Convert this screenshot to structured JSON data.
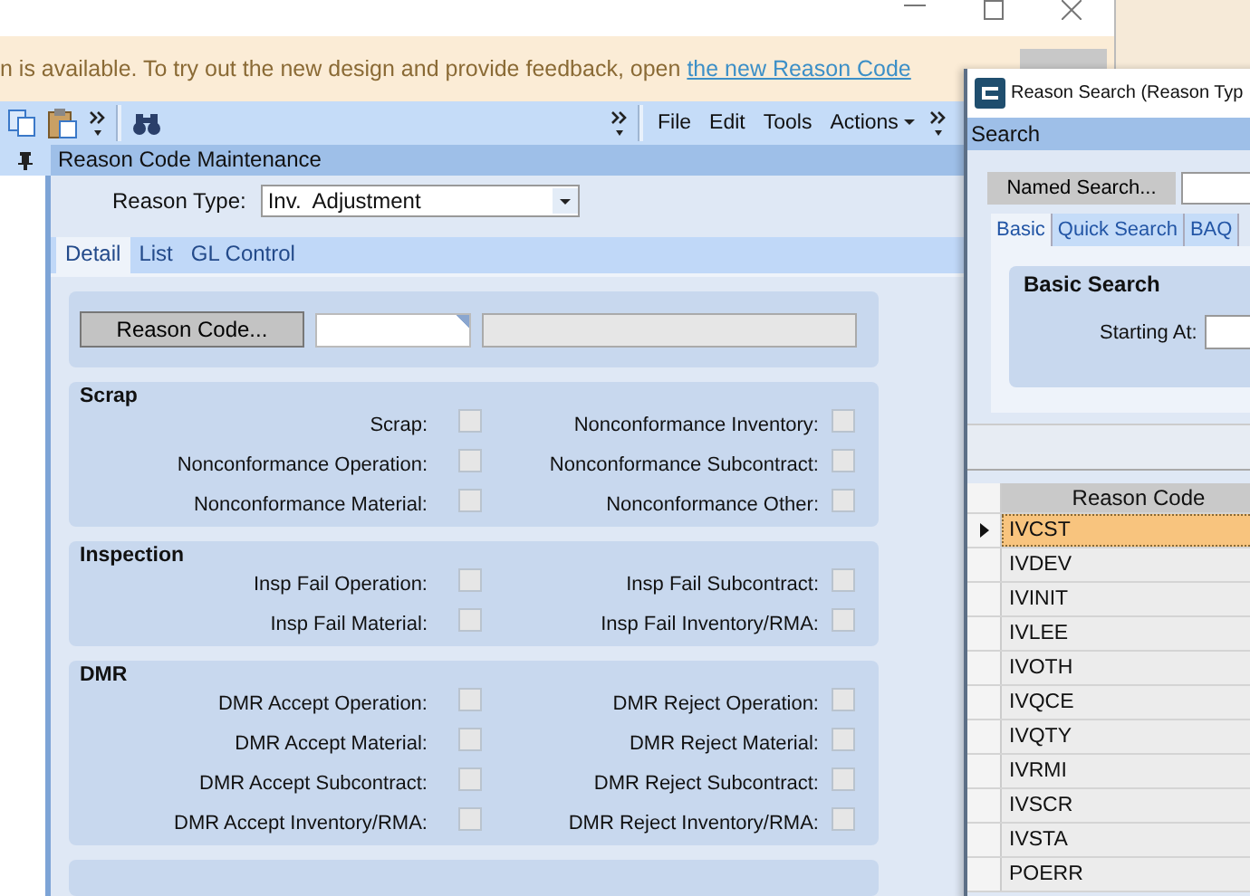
{
  "banner": {
    "text": "n is available. To try out the new design and provide feedback, open ",
    "link": "the new Reason Code"
  },
  "toolbar": {
    "menus": [
      {
        "label": "File",
        "kind": "plain"
      },
      {
        "label": "Edit",
        "kind": "plain"
      },
      {
        "label": "Tools",
        "kind": "plain"
      },
      {
        "label": "Actions",
        "kind": "dropdown"
      }
    ]
  },
  "form_title": "Reason Code Maintenance",
  "reason_type": {
    "label": "Reason Type:",
    "value": "Inv.  Adjustment"
  },
  "tabs": [
    {
      "label": "Detail",
      "selected": true
    },
    {
      "label": "List",
      "selected": false
    },
    {
      "label": "GL Control",
      "selected": false
    }
  ],
  "reason_code": {
    "button": "Reason Code..."
  },
  "sections": [
    {
      "title": "Scrap",
      "checkboxes": [
        {
          "label": "Scrap:",
          "checked": false
        },
        {
          "label": "Nonconformance Inventory:",
          "checked": false
        },
        {
          "label": "Nonconformance Operation:",
          "checked": false
        },
        {
          "label": "Nonconformance Subcontract:",
          "checked": false
        },
        {
          "label": "Nonconformance Material:",
          "checked": false
        },
        {
          "label": "Nonconformance Other:",
          "checked": false
        }
      ]
    },
    {
      "title": "Inspection",
      "checkboxes": [
        {
          "label": "Insp Fail Operation:",
          "checked": false
        },
        {
          "label": "Insp Fail Subcontract:",
          "checked": false
        },
        {
          "label": "Insp Fail Material:",
          "checked": false
        },
        {
          "label": "Insp Fail Inventory/RMA:",
          "checked": false
        }
      ]
    },
    {
      "title": "DMR",
      "checkboxes": [
        {
          "label": "DMR Accept Operation:",
          "checked": false
        },
        {
          "label": "DMR Reject Operation:",
          "checked": false
        },
        {
          "label": "DMR Accept Material:",
          "checked": false
        },
        {
          "label": "DMR Reject Material:",
          "checked": false
        },
        {
          "label": "DMR Accept Subcontract:",
          "checked": false
        },
        {
          "label": "DMR Reject Subcontract:",
          "checked": false
        },
        {
          "label": "DMR Accept Inventory/RMA:",
          "checked": false
        },
        {
          "label": "DMR Reject Inventory/RMA:",
          "checked": false
        }
      ]
    }
  ],
  "search_window": {
    "title": "Reason Search (Reason Typ",
    "header": "Search",
    "named_search": "Named Search...",
    "tabs": [
      {
        "label": "Basic",
        "selected": true
      },
      {
        "label": "Quick Search",
        "selected": false
      },
      {
        "label": "BAQ",
        "selected": false
      }
    ],
    "panel_title": "Basic Search",
    "starting_at": "Starting At:",
    "grid": {
      "columns": [
        "Reason Code"
      ],
      "rows": [
        {
          "code": "IVCST",
          "selected": true
        },
        {
          "code": "IVDEV",
          "selected": false
        },
        {
          "code": "IVINIT",
          "selected": false
        },
        {
          "code": "IVLEE",
          "selected": false
        },
        {
          "code": "IVOTH",
          "selected": false
        },
        {
          "code": "IVQCE",
          "selected": false
        },
        {
          "code": "IVQTY",
          "selected": false
        },
        {
          "code": "IVRMI",
          "selected": false
        },
        {
          "code": "IVSCR",
          "selected": false
        },
        {
          "code": "IVSTA",
          "selected": false
        },
        {
          "code": "POERR",
          "selected": false
        }
      ]
    }
  }
}
